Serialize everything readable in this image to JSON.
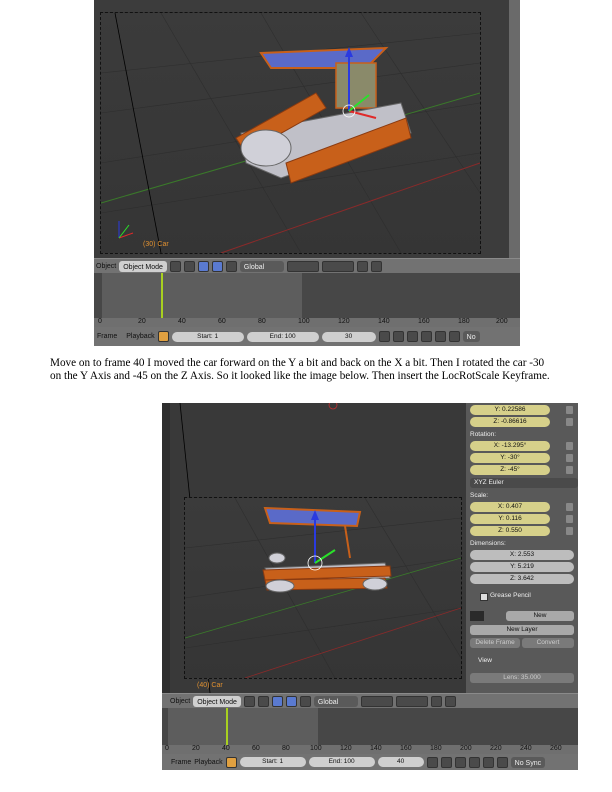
{
  "shot1": {
    "object_label": "(30) Car",
    "header": {
      "mode_label": "Object",
      "mode_select": "Object Mode",
      "orientation": "Global"
    },
    "ruler_ticks": [
      "0",
      "20",
      "40",
      "60",
      "80",
      "100",
      "120",
      "140",
      "160",
      "180",
      "200"
    ],
    "bottom": {
      "frame": "Frame",
      "playback": "Playback",
      "start": "Start: 1",
      "end": "End: 100",
      "current": "30",
      "extra": "No"
    }
  },
  "paragraph": "Move on to frame 40 I moved the car forward  on the Y a bit and back on the X a bit. Then I rotated the car -30 on the Y Axis and -45 on the Z Axis. So it looked like the image below. Then insert the LocRotScale Keyframe.",
  "shot2": {
    "object_label": "(40) Car",
    "header": {
      "mode_label": "Object",
      "mode_select": "Object Mode",
      "orientation": "Global"
    },
    "ruler_ticks": [
      "0",
      "20",
      "40",
      "60",
      "80",
      "100",
      "120",
      "140",
      "160",
      "180",
      "200",
      "220",
      "240",
      "260"
    ],
    "bottom": {
      "frame": "Frame",
      "playback": "Playback",
      "start": "Start: 1",
      "end": "End: 100",
      "current": "40",
      "sync": "No Sync"
    },
    "panel": {
      "loc_y": "Y: 0.22586",
      "loc_z": "Z: -0.86616",
      "rotation_label": "Rotation:",
      "rot_x": "X: -13.295°",
      "rot_y": "Y: -30°",
      "rot_z": "Z: -45°",
      "euler": "XYZ Euler",
      "scale_label": "Scale:",
      "scale_x": "X: 0.407",
      "scale_y": "Y: 0.116",
      "scale_z": "Z: 0.550",
      "dims_label": "Dimensions:",
      "dim_x": "X: 2.553",
      "dim_y": "Y: 5.219",
      "dim_z": "Z: 3.642",
      "grease_pencil": "Grease Pencil",
      "new": "New",
      "new_layer": "New Layer",
      "delete_frame": "Delete Frame",
      "convert": "Convert",
      "view": "View",
      "lens": "Lens: 35.000"
    }
  },
  "colors": {
    "orange": "#c8601a",
    "canopy": "#5a6ac8",
    "timeline_marker": "#a8d020"
  }
}
